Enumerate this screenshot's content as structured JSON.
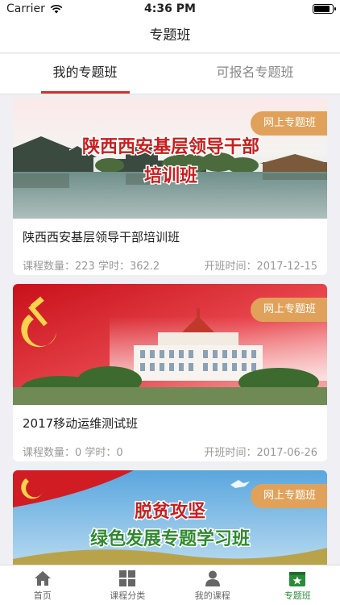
{
  "status_bar": {
    "carrier": "Carrier",
    "time": "4:36 PM",
    "battery_level": 0.9
  },
  "nav": {
    "title": "专题班"
  },
  "tabs": [
    {
      "label": "我的专题班",
      "active": true
    },
    {
      "label": "可报名专题班",
      "active": false
    }
  ],
  "cards": [
    {
      "badge": "网上专题班",
      "banner_line1": "陕西西安基层领导干部",
      "banner_line2": "培训班",
      "title": "陕西西安基层领导干部培训班",
      "meta_left": "课程数量：223 学时：362.2",
      "meta_right": "开班时间：2017-12-15"
    },
    {
      "badge": "网上专题班",
      "title": "2017移动运维测试班",
      "meta_left": "课程数量：0 学时：0",
      "meta_right": "开班时间：2017-06-26"
    },
    {
      "badge": "网上专题班",
      "banner_line1": "脱贫攻坚",
      "banner_line2": "绿色发展专题学习班"
    }
  ],
  "tabbar": [
    {
      "label": "首页",
      "icon": "home-icon",
      "active": false
    },
    {
      "label": "课程分类",
      "icon": "grid-icon",
      "active": false
    },
    {
      "label": "我的课程",
      "icon": "person-icon",
      "active": false
    },
    {
      "label": "专题班",
      "icon": "star-board-icon",
      "active": true
    }
  ],
  "colors": {
    "accent_red": "#d32f2f",
    "badge": "#e0a25b",
    "tab_active_green": "#2a8c3a"
  }
}
